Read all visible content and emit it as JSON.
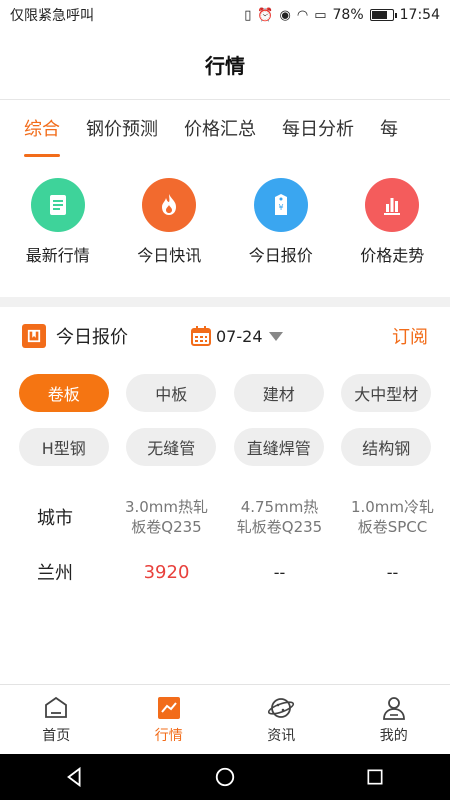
{
  "status": {
    "carrier": "仅限紧急呼叫",
    "battery": "78%",
    "time": "17:54",
    "battery_level": 0.78
  },
  "header": {
    "title": "行情"
  },
  "tabs": [
    {
      "label": "综合",
      "active": true
    },
    {
      "label": "钢价预测",
      "active": false
    },
    {
      "label": "价格汇总",
      "active": false
    },
    {
      "label": "每日分析",
      "active": false
    },
    {
      "label": "每",
      "active": false
    }
  ],
  "quick": [
    {
      "label": "最新行情",
      "icon": "document-icon",
      "color": "#3ed39a"
    },
    {
      "label": "今日快讯",
      "icon": "flame-icon",
      "color": "#f26a2e"
    },
    {
      "label": "今日报价",
      "icon": "price-tag-icon",
      "color": "#3aa6f0"
    },
    {
      "label": "价格走势",
      "icon": "bar-chart-icon",
      "color": "#f45c5c"
    }
  ],
  "section": {
    "title": "今日报价",
    "date": "07-24",
    "subscribe": "订阅"
  },
  "chips": [
    {
      "label": "卷板",
      "active": true
    },
    {
      "label": "中板",
      "active": false
    },
    {
      "label": "建材",
      "active": false
    },
    {
      "label": "大中型材",
      "active": false
    },
    {
      "label": "H型钢",
      "active": false
    },
    {
      "label": "无缝管",
      "active": false
    },
    {
      "label": "直缝焊管",
      "active": false
    },
    {
      "label": "结构钢",
      "active": false
    }
  ],
  "table": {
    "headers": [
      "城市",
      "3.0mm热轧板卷Q235",
      "4.75mm热轧板卷Q235",
      "1.0mm冷轧板卷SPCC"
    ],
    "header_lines": [
      [
        "3.0mm热轧",
        "板卷Q235"
      ],
      [
        "4.75mm热",
        "轧板卷Q235"
      ],
      [
        "1.0mm冷轧",
        "板卷SPCC"
      ]
    ],
    "rows": [
      [
        "兰州",
        "3920",
        "--",
        "--"
      ]
    ]
  },
  "bottom_nav": [
    {
      "label": "首页",
      "icon": "home-icon",
      "active": false
    },
    {
      "label": "行情",
      "icon": "trend-icon",
      "active": true
    },
    {
      "label": "资讯",
      "icon": "news-planet-icon",
      "active": false
    },
    {
      "label": "我的",
      "icon": "user-icon",
      "active": false
    }
  ],
  "colors": {
    "accent": "#f26c1a",
    "price_red": "#e8413c"
  }
}
